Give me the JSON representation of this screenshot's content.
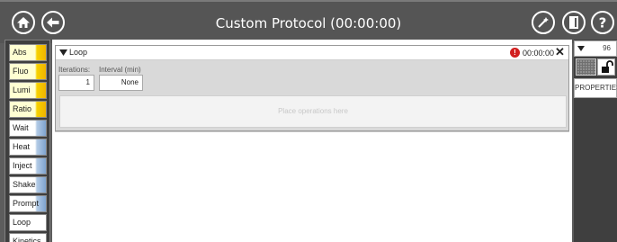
{
  "titlebar": {
    "title": "Custom Protocol (00:00:00)",
    "icons": [
      "home-icon",
      "back-arrow-icon",
      "wand-icon",
      "exit-door-icon",
      "help-icon"
    ]
  },
  "palette": {
    "items": [
      {
        "label": "Abs",
        "color": "yellow"
      },
      {
        "label": "Fluo",
        "color": "yellow"
      },
      {
        "label": "Lumi",
        "color": "yellow"
      },
      {
        "label": "Ratio",
        "color": "yellow"
      },
      {
        "label": "Wait",
        "color": "blue"
      },
      {
        "label": "Heat",
        "color": "blue"
      },
      {
        "label": "Inject",
        "color": "blue"
      },
      {
        "label": "Shake",
        "color": "blue"
      },
      {
        "label": "Prompt",
        "color": "blue"
      },
      {
        "label": "Loop",
        "color": "white"
      },
      {
        "label": "Kinetics",
        "color": "white"
      }
    ]
  },
  "loop": {
    "title": "Loop",
    "time": "00:00:00",
    "iterations_label": "Iterations:",
    "iterations_value": "1",
    "interval_label": "Interval (min)",
    "interval_value": "None",
    "drop_placeholder": "Place operations here"
  },
  "rightpanel": {
    "plate_value": "96",
    "properties_label": "PROPERTIES"
  },
  "colors": {
    "titlebar_bg": "#555555",
    "panel_bg": "#3f3f3f",
    "yellow_accent": "#f0b400",
    "blue_accent": "#7ea3cf",
    "warning_red": "#d11f1f"
  }
}
